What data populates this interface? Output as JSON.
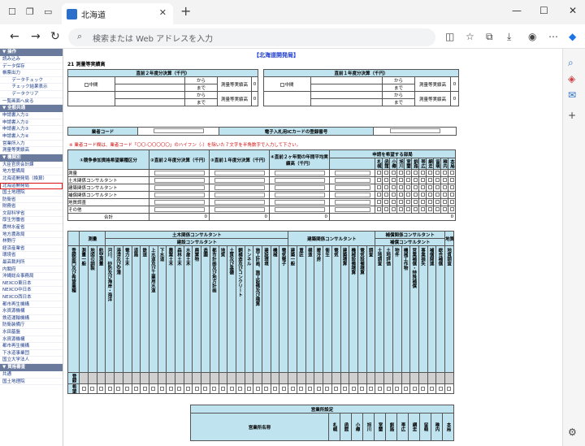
{
  "browser": {
    "tab_title": "北海道",
    "address_placeholder": "検索または Web アドレスを入力",
    "win_minimize": "—",
    "win_maximize": "☐",
    "win_close": "✕"
  },
  "sidebar": {
    "sections": [
      {
        "title": "▼ 操作",
        "items": [
          "読み込み",
          "データ保存",
          "帳票出力",
          "　データチェック",
          "　チェック結果表示",
          "　データクリア",
          "一覧画面へ戻る"
        ]
      },
      {
        "title": "▼ 全般共通",
        "items": [
          "申請書入力①",
          "申請書入力②",
          "申請書入力③",
          "申請書入力④",
          "営業所入力",
          "測量等実績高"
        ]
      },
      {
        "title": "▼ 機関別",
        "items": [
          "大臣官房会計課",
          "地方整備局",
          "北海道開発局（換算）",
          "北海道開発局",
          "国土地理院",
          "防衛省",
          "財務省",
          "文部科学省",
          "厚生労働省",
          "農林水産省",
          "地方農政局",
          "林野庁",
          "経済産業省",
          "環境省",
          "最高裁判所",
          "内閣府",
          "沖縄総合事務局",
          "NEXCO東日本",
          "NEXCO中日本",
          "NEXCO西日本",
          "都市再生機構",
          "水資源機構",
          "鉄道運輸機構",
          "防衛装備庁",
          "水田基盤",
          "水資源機構",
          "都市再生機構",
          "下水道事業団",
          "国立大学法人"
        ]
      },
      {
        "title": "▼ 資格審査",
        "items": [
          "共通",
          "国土地理院"
        ]
      }
    ],
    "highlighted_item": "北海道開発局"
  },
  "main": {
    "org_title": "【北海道開発局】",
    "section_title": "21 測量等実績高",
    "kessan": {
      "prev2_header": "直前２年度分決算（千円）",
      "prev1_header": "直前１年度分決算（千円）",
      "middle": "中間",
      "from": "から",
      "to": "まで",
      "label": "測量等実績高",
      "zero": "0"
    },
    "gyosha": {
      "code_label": "業者コード",
      "card_label": "電子入札用ICカードの登録番号"
    },
    "note": "※ 業者コード欄は、業者コード「〇〇-〇〇〇〇〇」のハイフン（-）を除いた７文字を半角数字で入力して下さい。",
    "kyoso": {
      "col1": "①競争参加資格希望業種区分",
      "col2": "②直前２年度分決算（千円）",
      "col3": "③直前１年度分決算（千円）",
      "col4": "④直前２ヶ年間の年間平均実績高（千円）",
      "col5": "申請を希望する部局",
      "depts": [
        "札幌",
        "函館",
        "小樽",
        "旭川",
        "室蘭",
        "釧路",
        "帯広",
        "網走",
        "留萌",
        "稚内",
        "本局"
      ],
      "rows": [
        "測量",
        "土木関係コンサルタント",
        "建築関係コンサルタント",
        "補償関係コンサルタント",
        "地質調査",
        "その他"
      ],
      "total": "合計",
      "zero": "0",
      "total_dept": "0"
    },
    "license": {
      "survey_group": "測量",
      "civil_group": "土木関係コンサルタント",
      "civil_sub": "建設コンサルタント",
      "arch_group": "建築関係コンサルタント",
      "comp_group": "補償関係コンサルタント",
      "comp_sub": "補償コンサルタント",
      "geo_group": "地質調査",
      "row_label": "登録部門及び希望業種",
      "reg_row": "登録",
      "wish_row": "希望",
      "survey_cols": [
        "測量一般",
        "地図の調製",
        "航空測量"
      ],
      "civil_cols": [
        "河川、砂防及び海岸・海洋",
        "港湾及び空港",
        "電力土木",
        "道路",
        "鉄道",
        "上水道及び工業用水道",
        "下水道",
        "農業土木",
        "森林土木",
        "水産土木",
        "廃棄物",
        "造園",
        "都市計画及び地方計画",
        "地質",
        "土質及び基礎",
        "鋼構造及びコンクリート",
        "トンネル",
        "施工計画、施工設備及び積算",
        "建設環境",
        "機械",
        "電気電子"
      ],
      "arch_cols": [
        "建築一般",
        "意匠",
        "構造",
        "暖冷房",
        "衛生",
        "電気",
        "建築積算",
        "機械設備積算",
        "電気設備積算",
        "調査"
      ],
      "comp_cols": [
        "土地調査",
        "土地評価",
        "物件",
        "機械工作物",
        "営業補償・特殊補償",
        "事業損失",
        "補償関連",
        "総合補償"
      ],
      "geo_cols": [
        "地質調査"
      ]
    },
    "eigyo": {
      "title": "営業所設定",
      "name_label": "営業所名称",
      "depts": [
        "札幌",
        "函館",
        "小樽",
        "旭川",
        "室蘭",
        "釧路",
        "帯広",
        "網走",
        "留萌",
        "稚内",
        "本局"
      ]
    }
  },
  "colors": {
    "header_bg": "#bfe3ef",
    "sidebar_head": "#6a7a9c",
    "link": "#1a3a8a",
    "note": "#d01010",
    "highlight": "#e01818"
  }
}
